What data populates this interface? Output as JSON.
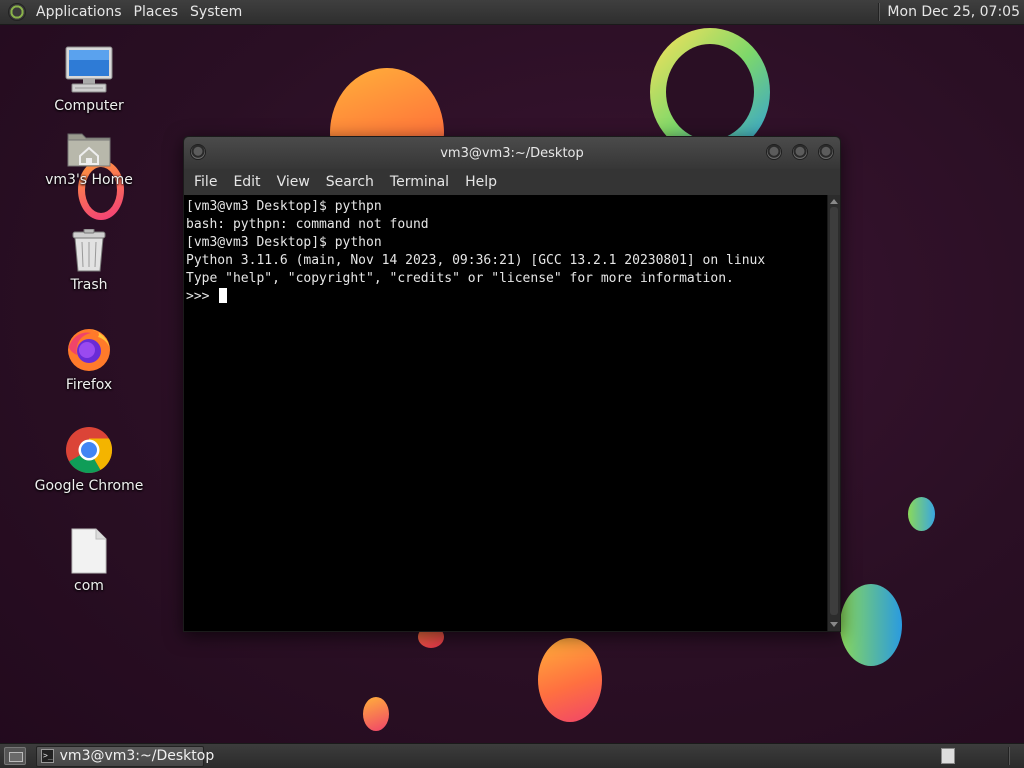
{
  "top_panel": {
    "menus": [
      "Applications",
      "Places",
      "System"
    ],
    "clock": "Mon Dec 25, 07:05"
  },
  "desktop_icons": [
    {
      "label": "Computer",
      "icon": "computer-icon"
    },
    {
      "label": "vm3's Home",
      "icon": "home-folder-icon"
    },
    {
      "label": "Trash",
      "icon": "trash-icon"
    },
    {
      "label": "Firefox",
      "icon": "firefox-icon"
    },
    {
      "label": "Google Chrome",
      "icon": "chrome-icon"
    },
    {
      "label": "com",
      "icon": "file-icon"
    }
  ],
  "terminal": {
    "title": "vm3@vm3:~/Desktop",
    "menu": [
      "File",
      "Edit",
      "View",
      "Search",
      "Terminal",
      "Help"
    ],
    "lines": [
      "[vm3@vm3 Desktop]$ pythpn",
      "bash: pythpn: command not found",
      "[vm3@vm3 Desktop]$ python",
      "Python 3.11.6 (main, Nov 14 2023, 09:36:21) [GCC 13.2.1 20230801] on linux",
      "Type \"help\", \"copyright\", \"credits\" or \"license\" for more information.",
      ">>> "
    ]
  },
  "bottom_panel": {
    "task": "vm3@vm3:~/Desktop"
  },
  "colors": {
    "desktop_bg": "#2a0f24",
    "terminal_bg": "#000000",
    "terminal_fg": "#e6e6e6",
    "panel_bg": "#353535"
  }
}
